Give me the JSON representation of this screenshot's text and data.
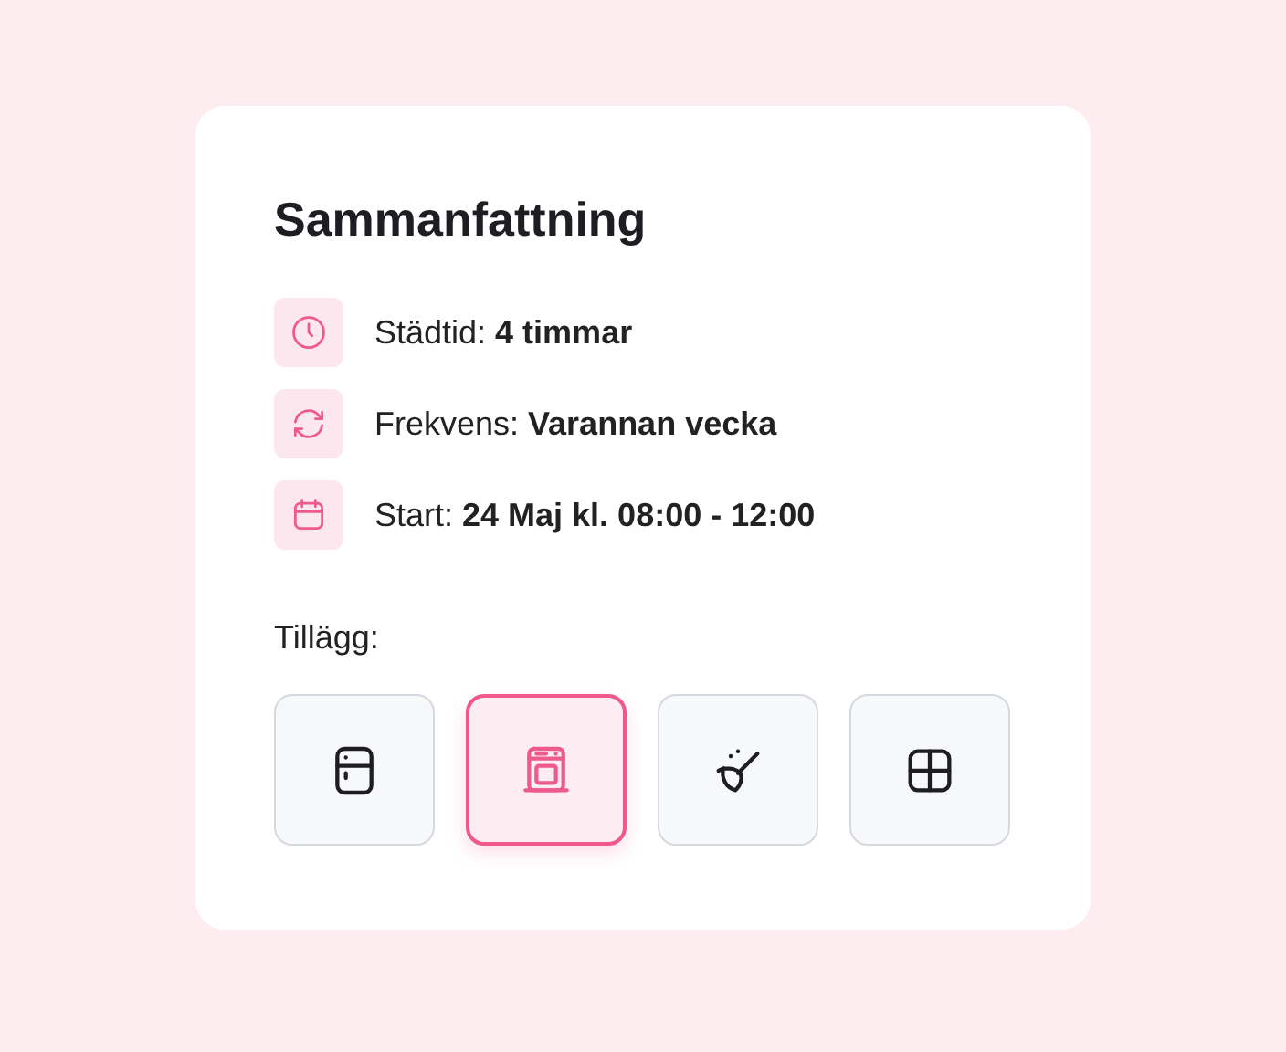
{
  "card": {
    "title": "Sammanfattning",
    "details": [
      {
        "kind": "clock",
        "text": "Städtid: **4 timmar**"
      },
      {
        "kind": "repeat",
        "text": "Frekvens: **Varannan vecka**"
      },
      {
        "kind": "calendar",
        "text": "Start: **24 Maj kl. 08:00 - 12:00**"
      }
    ],
    "addons_label": "Tillägg:",
    "addons": [
      {
        "kind": "fridge",
        "selected": false
      },
      {
        "kind": "oven",
        "selected": true
      },
      {
        "kind": "broom",
        "selected": false
      },
      {
        "kind": "window",
        "selected": false
      }
    ]
  }
}
